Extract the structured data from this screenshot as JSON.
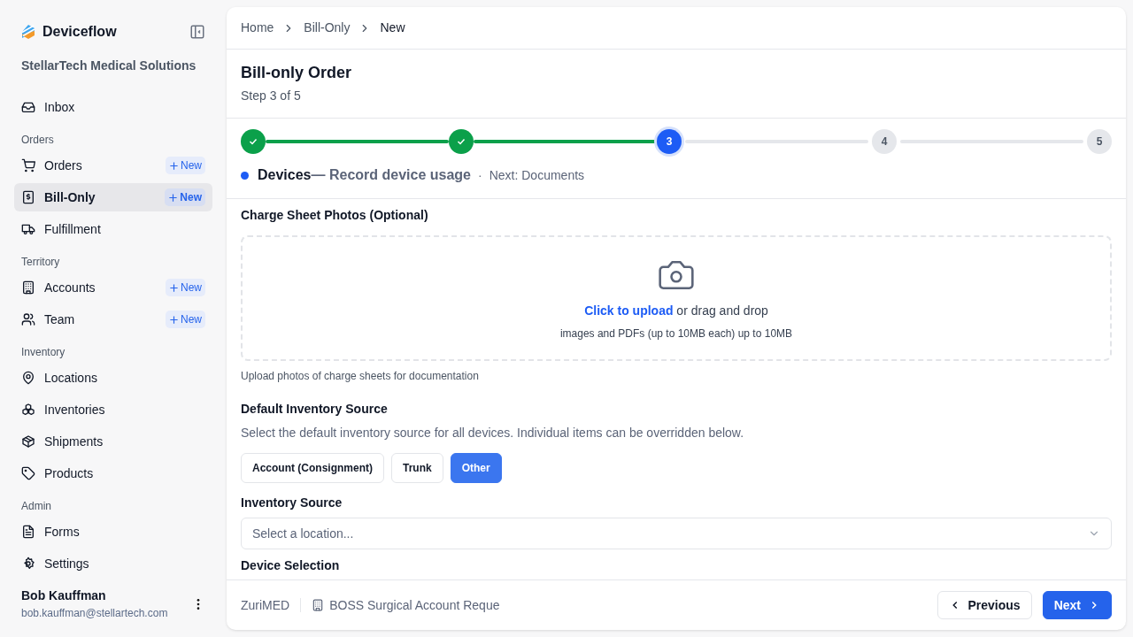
{
  "app": {
    "name": "Deviceflow",
    "org": "StellarTech Medical Solutions"
  },
  "sidebar": {
    "items": [
      {
        "kind": "link",
        "label": "Inbox",
        "selected": false
      },
      {
        "kind": "section",
        "label": "Orders"
      },
      {
        "kind": "link",
        "label": "Orders",
        "selected": false,
        "action": "New"
      },
      {
        "kind": "link",
        "label": "Bill-Only",
        "selected": true,
        "action": "New"
      },
      {
        "kind": "link",
        "label": "Fulfillment",
        "selected": false
      },
      {
        "kind": "section",
        "label": "Territory"
      },
      {
        "kind": "link",
        "label": "Accounts",
        "selected": false,
        "action": "New"
      },
      {
        "kind": "link",
        "label": "Team",
        "selected": false,
        "action": "New"
      },
      {
        "kind": "section",
        "label": "Inventory"
      },
      {
        "kind": "link",
        "label": "Locations",
        "selected": false
      },
      {
        "kind": "link",
        "label": "Inventories",
        "selected": false
      },
      {
        "kind": "link",
        "label": "Shipments",
        "selected": false
      },
      {
        "kind": "link",
        "label": "Products",
        "selected": false
      },
      {
        "kind": "section",
        "label": "Admin"
      },
      {
        "kind": "link",
        "label": "Forms",
        "selected": false
      },
      {
        "kind": "link",
        "label": "Settings",
        "selected": false
      }
    ]
  },
  "user": {
    "name": "Bob Kauffman",
    "email": "bob.kauffman@stellartech.com"
  },
  "breadcrumb": [
    "Home",
    "Bill-Only",
    "New"
  ],
  "page": {
    "title": "Bill-only Order",
    "step": "Step 3 of 5"
  },
  "stepper": {
    "steps": [
      {
        "done": true,
        "current": false
      },
      {
        "done": true,
        "current": false
      },
      {
        "done": false,
        "current": true,
        "number": "3"
      },
      {
        "done": false,
        "current": false,
        "number": "4"
      },
      {
        "done": false,
        "current": false,
        "number": "5"
      }
    ],
    "current": {
      "name": "Devices",
      "description": "— Record device usage",
      "separator": "·",
      "next": "Next: Documents"
    }
  },
  "upload": {
    "label": "Charge Sheet Photos (Optional)",
    "link": "Click to upload",
    "text": "or drag and drop",
    "hint": "images and PDFs (up to 10MB each) up to 10MB",
    "help": "Upload photos of charge sheets for documentation"
  },
  "default_source": {
    "title": "Default Inventory Source",
    "description": "Select the default inventory source for all devices. Individual items can be overridden below.",
    "options": [
      {
        "label": "Account (Consignment)",
        "selected": false
      },
      {
        "label": "Trunk",
        "selected": false
      },
      {
        "label": "Other",
        "selected": true
      }
    ]
  },
  "inventory_source": {
    "label": "Inventory Source",
    "placeholder": "Select a location..."
  },
  "device_selection": {
    "title": "Device Selection"
  },
  "footer": {
    "account": "ZuriMED",
    "facility": "BOSS Surgical Account Reque",
    "buttons": [
      {
        "kind": "previous",
        "label": "Previous"
      },
      {
        "kind": "next",
        "label": "Next"
      }
    ]
  }
}
